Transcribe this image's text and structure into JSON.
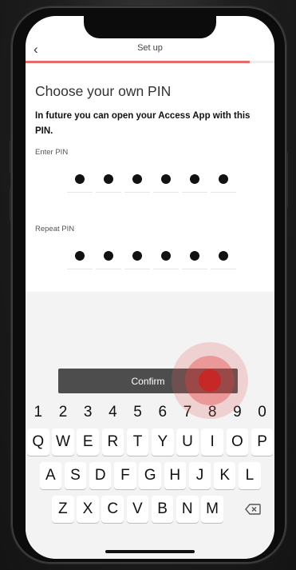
{
  "appbar": {
    "back_icon": "chevron-left-icon",
    "title": "Set up"
  },
  "progress": {
    "fraction": 0.9,
    "color": "#e46b6b"
  },
  "content": {
    "heading": "Choose your own PIN",
    "description": "In future you can open your Access App with this PIN.",
    "enter_label": "Enter PIN",
    "repeat_label": "Repeat PIN",
    "pin_length": 6,
    "enter_filled": 6,
    "repeat_filled": 6
  },
  "confirm_label": "Confirm",
  "keyboard": {
    "numbers": [
      "1",
      "2",
      "3",
      "4",
      "5",
      "6",
      "7",
      "8",
      "9",
      "0"
    ],
    "row1": [
      "Q",
      "W",
      "E",
      "R",
      "T",
      "Y",
      "U",
      "I",
      "O",
      "P"
    ],
    "row2": [
      "A",
      "S",
      "D",
      "F",
      "G",
      "H",
      "J",
      "K",
      "L"
    ],
    "row3": [
      "Z",
      "X",
      "C",
      "V",
      "B",
      "N",
      "M"
    ],
    "delete_icon": "backspace-icon"
  },
  "colors": {
    "accent": "#e46b6b",
    "tap": "#c62828",
    "button": "#4d4d4d"
  }
}
